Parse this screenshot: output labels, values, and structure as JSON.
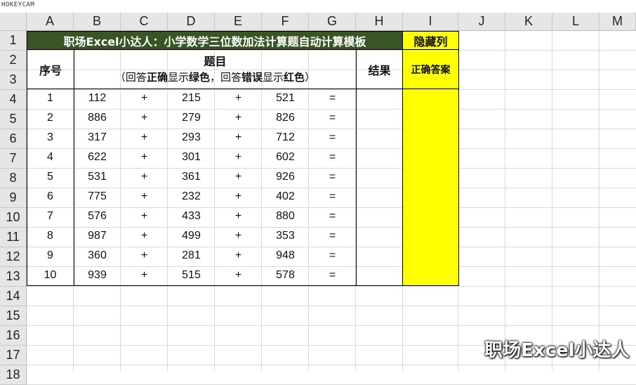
{
  "watermark_top": "HOKEYCAM",
  "watermark_bottom": "职场Excel小达人",
  "columns": [
    "A",
    "B",
    "C",
    "D",
    "E",
    "F",
    "G",
    "H",
    "I",
    "J",
    "K",
    "L",
    "M"
  ],
  "rows": [
    "1",
    "2",
    "3",
    "4",
    "5",
    "6",
    "7",
    "8",
    "9",
    "10",
    "11",
    "12",
    "13",
    "14",
    "15",
    "16",
    "17",
    "18"
  ],
  "title": "职场Excel小达人：小学数学三位数加法计算题自动计算模板",
  "hidden_col_label": "隐藏列",
  "header": {
    "seq": "序号",
    "topic": "题目",
    "topic_sub_parts": [
      "（回答",
      "正确",
      "显示",
      "绿色",
      "，回答",
      "错误",
      "显示",
      "红色",
      "）"
    ],
    "result": "结果",
    "correct_answer": "正确答案"
  },
  "problems": [
    {
      "n": "1",
      "a": "112",
      "op1": "+",
      "b": "215",
      "op2": "+",
      "c": "521",
      "eq": "="
    },
    {
      "n": "2",
      "a": "886",
      "op1": "+",
      "b": "279",
      "op2": "+",
      "c": "826",
      "eq": "="
    },
    {
      "n": "3",
      "a": "317",
      "op1": "+",
      "b": "293",
      "op2": "+",
      "c": "712",
      "eq": "="
    },
    {
      "n": "4",
      "a": "622",
      "op1": "+",
      "b": "301",
      "op2": "+",
      "c": "602",
      "eq": "="
    },
    {
      "n": "5",
      "a": "531",
      "op1": "+",
      "b": "361",
      "op2": "+",
      "c": "926",
      "eq": "="
    },
    {
      "n": "6",
      "a": "775",
      "op1": "+",
      "b": "232",
      "op2": "+",
      "c": "402",
      "eq": "="
    },
    {
      "n": "7",
      "a": "576",
      "op1": "+",
      "b": "433",
      "op2": "+",
      "c": "880",
      "eq": "="
    },
    {
      "n": "8",
      "a": "987",
      "op1": "+",
      "b": "499",
      "op2": "+",
      "c": "353",
      "eq": "="
    },
    {
      "n": "9",
      "a": "360",
      "op1": "+",
      "b": "281",
      "op2": "+",
      "c": "948",
      "eq": "="
    },
    {
      "n": "10",
      "a": "939",
      "op1": "+",
      "b": "515",
      "op2": "+",
      "c": "578",
      "eq": "="
    }
  ],
  "colors": {
    "title_bg": "#375623",
    "highlight": "#ffff00",
    "green_text": "#00a000",
    "red_text": "#e00000"
  }
}
